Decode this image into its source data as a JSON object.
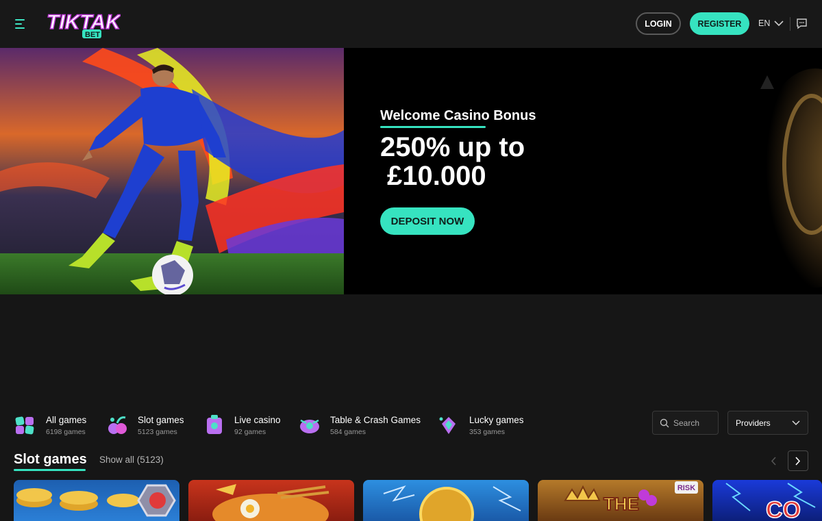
{
  "header": {
    "login_label": "LOGIN",
    "register_label": "REGISTER",
    "language": "EN",
    "icons": {
      "menu": "hamburger-icon",
      "language_chevron": "chevron-down-icon",
      "chat": "chat-icon"
    },
    "logo": {
      "text": "TIKTAK",
      "subtext": "BET"
    }
  },
  "hero": {
    "subtitle": "Welcome Casino Bonus",
    "title_line1": "250% up to",
    "title_line2": "£10.000",
    "cta_label": "DEPOSIT NOW"
  },
  "categories": [
    {
      "label": "All games",
      "count": "6198 games",
      "icon": "all-games-icon"
    },
    {
      "label": "Slot games",
      "count": "5123 games",
      "icon": "slot-games-icon"
    },
    {
      "label": "Live casino",
      "count": "92 games",
      "icon": "live-casino-icon"
    },
    {
      "label": "Table & Crash Games",
      "count": "584 games",
      "icon": "table-crash-icon"
    },
    {
      "label": "Lucky games",
      "count": "353 games",
      "icon": "lucky-games-icon"
    }
  ],
  "search": {
    "placeholder": "Search"
  },
  "providers": {
    "label": "Providers"
  },
  "section": {
    "title": "Slot games",
    "show_all": "Show all (5123)"
  },
  "colors": {
    "accent": "#36e3c0",
    "background": "#161616",
    "header": "#181818"
  }
}
